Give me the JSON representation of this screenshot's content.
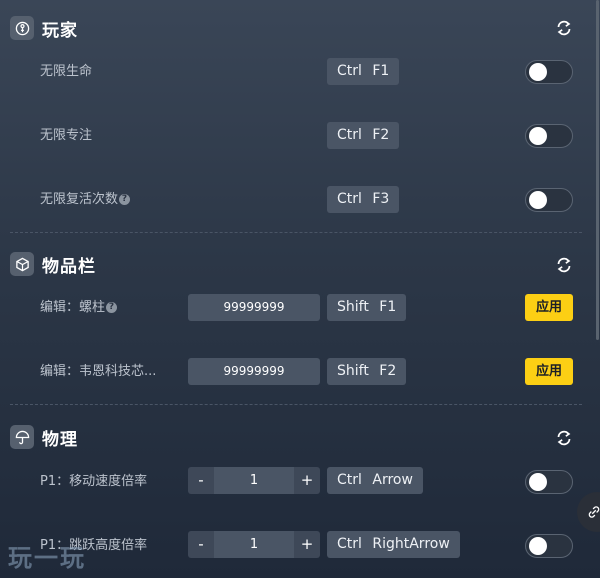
{
  "sections": {
    "player": {
      "title": "玩家",
      "rows": [
        {
          "label": "无限生命",
          "hotkey": "Ctrl F1"
        },
        {
          "label": "无限专注",
          "hotkey": "Ctrl F2"
        },
        {
          "label": "无限复活次数",
          "hotkey": "Ctrl F3"
        }
      ]
    },
    "inventory": {
      "title": "物品栏",
      "rows": [
        {
          "label": "编辑：螺柱",
          "value": "99999999",
          "hotkey": "Shift F1",
          "apply": "应用"
        },
        {
          "label": "编辑：韦恩科技芯...",
          "value": "99999999",
          "hotkey": "Shift F2",
          "apply": "应用"
        }
      ]
    },
    "physics": {
      "title": "物理",
      "rows": [
        {
          "label": "P1：移动速度倍率",
          "value": "1",
          "hotkey": "Ctrl Arrow"
        },
        {
          "label": "P1：跳跃高度倍率",
          "value": "1",
          "hotkey": "Ctrl RightArrow"
        }
      ]
    }
  },
  "stepper": {
    "minus": "-",
    "plus": "+"
  },
  "help_mark": "?",
  "watermark": "玩一玩",
  "colors": {
    "accent": "#fccf14",
    "toggle_knob": "#ffffff",
    "hotkey_bg": "#4a5565"
  }
}
